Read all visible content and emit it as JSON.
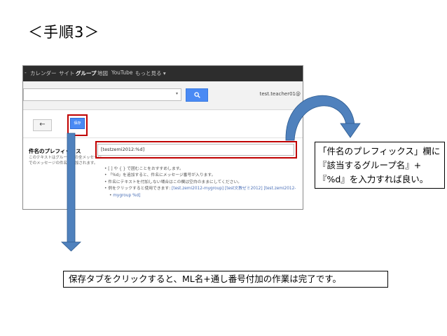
{
  "slide_title": "＜手順3＞",
  "screenshot": {
    "nav_items": [
      {
        "label": "カレンダー",
        "active": false
      },
      {
        "label": "サイト",
        "active": false
      },
      {
        "label": "グループ",
        "active": true
      },
      {
        "label": "地図",
        "active": false
      },
      {
        "label": "YouTube",
        "active": false
      },
      {
        "label": "もっと見る ▾",
        "active": false
      }
    ],
    "nav_bullet": "-",
    "search_dropdown_icon": "▾",
    "account": "test.teacher01@",
    "back_icon": "←",
    "save_label": "保存",
    "setting_title": "件名のプレフィックス",
    "setting_desc_1": "このテキストはグループへの全メッセージ",
    "setting_desc_2": "でのメッセージの件名に付加されます。",
    "prefix_value": "[testzemi2012:%d]",
    "notes": [
      "[ ] や { } で囲むことをおすすめします。",
      "「%d」を追加すると、件名にメッセージ番号が入ります。",
      "件名にテキストを付加しない場合はこの欄は空白のままにしてください。"
    ],
    "example_prefix": "例をクリックすると使用できます:",
    "examples": [
      "[test.zemi2012-mygroup]",
      "[test文教ゼミ2012]",
      "[test.zemi2012-"
    ],
    "example_cont": "mygroup %d]"
  },
  "callout_right": [
    "「件名のプレフィックス」欄に",
    "『該当するグループ名』+",
    "『%d』を入力すれば良い。"
  ],
  "callout_bottom": "保存タブをクリックすると、ML名+通し番号付加の作業は完了です。",
  "colors": {
    "highlight": "#c00000",
    "arrow": "#4f81bd",
    "button": "#4a8af4"
  }
}
